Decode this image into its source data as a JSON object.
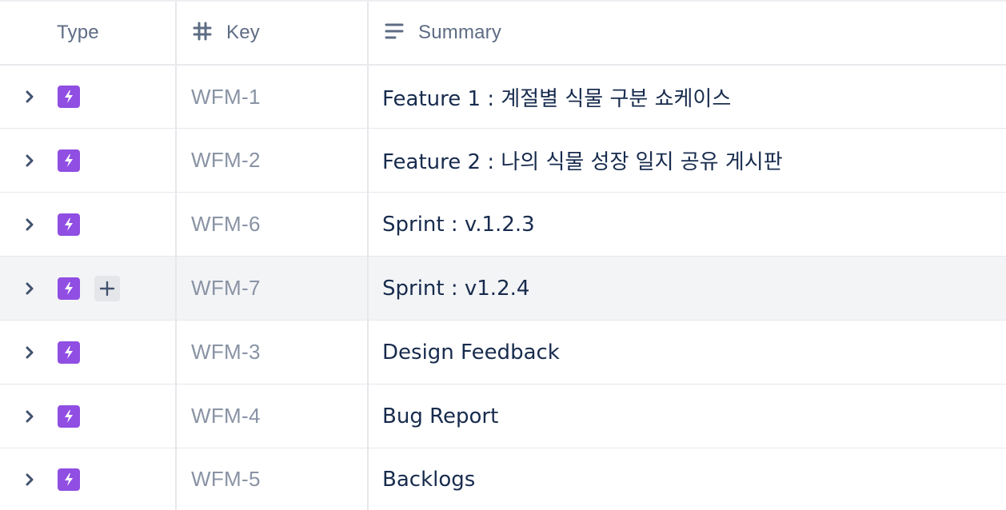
{
  "header": {
    "type_label": "Type",
    "key_label": "Key",
    "summary_label": "Summary"
  },
  "colors": {
    "epic": "#904ee2",
    "key_text": "#8993a4",
    "summary_text": "#172b4d",
    "header_text": "#5e6c84",
    "hover_row": "#f3f4f6"
  },
  "rows": [
    {
      "key": "WFM-1",
      "summary": "Feature 1 : 계절별 식물 구분 쇼케이스",
      "type_icon": "epic-lightning-icon"
    },
    {
      "key": "WFM-2",
      "summary": "Feature 2 : 나의 식물 성장 일지 공유 게시판",
      "type_icon": "epic-lightning-icon"
    },
    {
      "key": "WFM-6",
      "summary": "Sprint : v.1.2.3",
      "type_icon": "epic-lightning-icon"
    },
    {
      "key": "WFM-7",
      "summary": "Sprint : v1.2.4",
      "type_icon": "epic-lightning-icon",
      "hovered": true
    },
    {
      "key": "WFM-3",
      "summary": "Design Feedback",
      "type_icon": "epic-lightning-icon"
    },
    {
      "key": "WFM-4",
      "summary": "Bug Report",
      "type_icon": "epic-lightning-icon"
    },
    {
      "key": "WFM-5",
      "summary": "Backlogs",
      "type_icon": "epic-lightning-icon"
    }
  ]
}
